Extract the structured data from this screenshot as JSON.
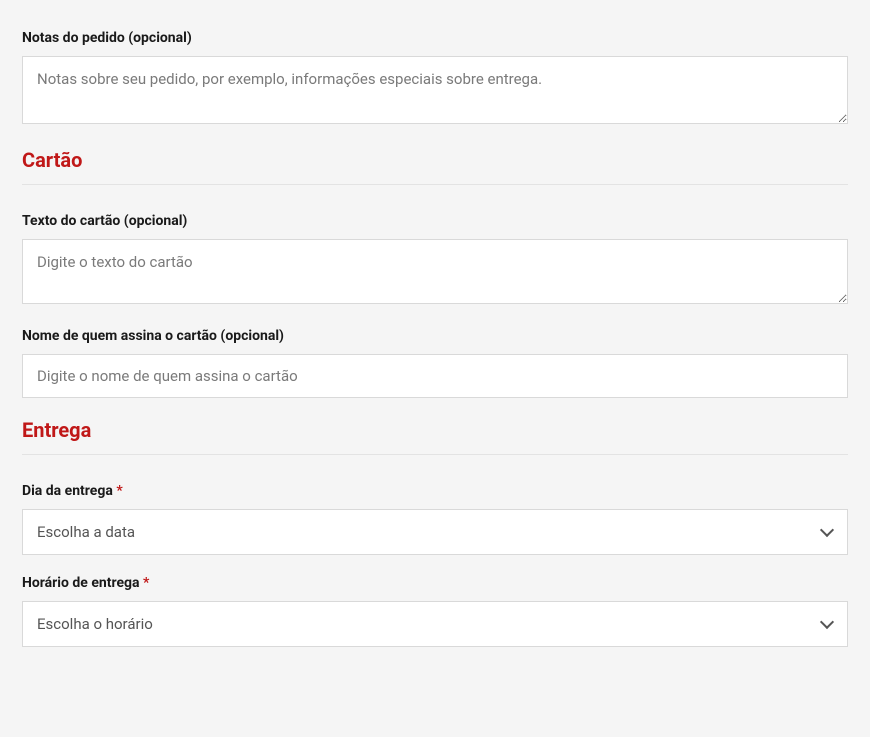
{
  "order_notes": {
    "label": "Notas do pedido (opcional)",
    "placeholder": "Notas sobre seu pedido, por exemplo, informações especiais sobre entrega.",
    "value": ""
  },
  "card_section": {
    "heading": "Cartão"
  },
  "card_text": {
    "label": "Texto do cartão (opcional)",
    "placeholder": "Digite o texto do cartão",
    "value": ""
  },
  "card_signer": {
    "label": "Nome de quem assina o cartão (opcional)",
    "placeholder": "Digite o nome de quem assina o cartão",
    "value": ""
  },
  "delivery_section": {
    "heading": "Entrega"
  },
  "delivery_date": {
    "label": "Dia da entrega ",
    "required_mark": "*",
    "placeholder": "Escolha a data"
  },
  "delivery_time": {
    "label": "Horário de entrega ",
    "required_mark": "*",
    "placeholder": "Escolha o horário"
  }
}
